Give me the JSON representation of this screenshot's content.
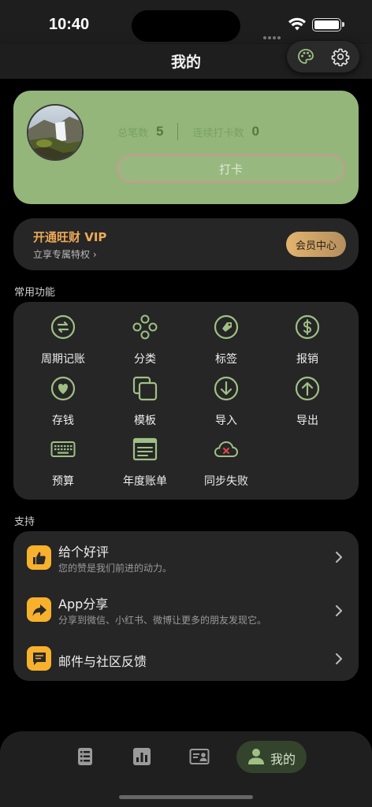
{
  "status_bar": {
    "time": "10:40"
  },
  "header": {
    "title": "我的",
    "palette_icon": "palette-icon",
    "settings_icon": "gear-icon"
  },
  "profile": {
    "total_label": "总笔数",
    "total_value": "5",
    "streak_label": "连续打卡数",
    "streak_value": "0",
    "checkin_label": "打卡",
    "card_color": "#94b67b"
  },
  "vip": {
    "title": "开通旺财 VIP",
    "subtitle": "立享专属特权 ›",
    "button": "会员中心",
    "accent": "#eea957"
  },
  "functions": {
    "title": "常用功能",
    "items": [
      {
        "label": "周期记账",
        "icon": "recurring-icon"
      },
      {
        "label": "分类",
        "icon": "category-icon"
      },
      {
        "label": "标签",
        "icon": "tag-icon"
      },
      {
        "label": "报销",
        "icon": "reimburse-icon"
      },
      {
        "label": "存钱",
        "icon": "savings-icon"
      },
      {
        "label": "模板",
        "icon": "template-icon"
      },
      {
        "label": "导入",
        "icon": "import-icon"
      },
      {
        "label": "导出",
        "icon": "export-icon"
      },
      {
        "label": "预算",
        "icon": "keyboard-icon"
      },
      {
        "label": "年度账单",
        "icon": "annual-bill-icon"
      },
      {
        "label": "同步失败",
        "icon": "sync-failed-icon"
      }
    ]
  },
  "support": {
    "title": "支持",
    "items": [
      {
        "title": "给个好评",
        "subtitle": "您的赞是我们前进的动力。",
        "icon": "thumbs-up-icon"
      },
      {
        "title": "App分享",
        "subtitle": "分享到微信、小红书、微博让更多的朋友发现它。",
        "icon": "share-icon"
      },
      {
        "title": "邮件与社区反馈",
        "subtitle": "",
        "icon": "feedback-icon"
      }
    ],
    "icon_color": "#f7b12c"
  },
  "tab_bar": {
    "tabs": [
      {
        "name": "list-icon"
      },
      {
        "name": "chart-icon"
      },
      {
        "name": "account-card-icon"
      },
      {
        "name": "person-icon",
        "label": "我的",
        "active": true
      }
    ],
    "active_color": "#33432c"
  }
}
